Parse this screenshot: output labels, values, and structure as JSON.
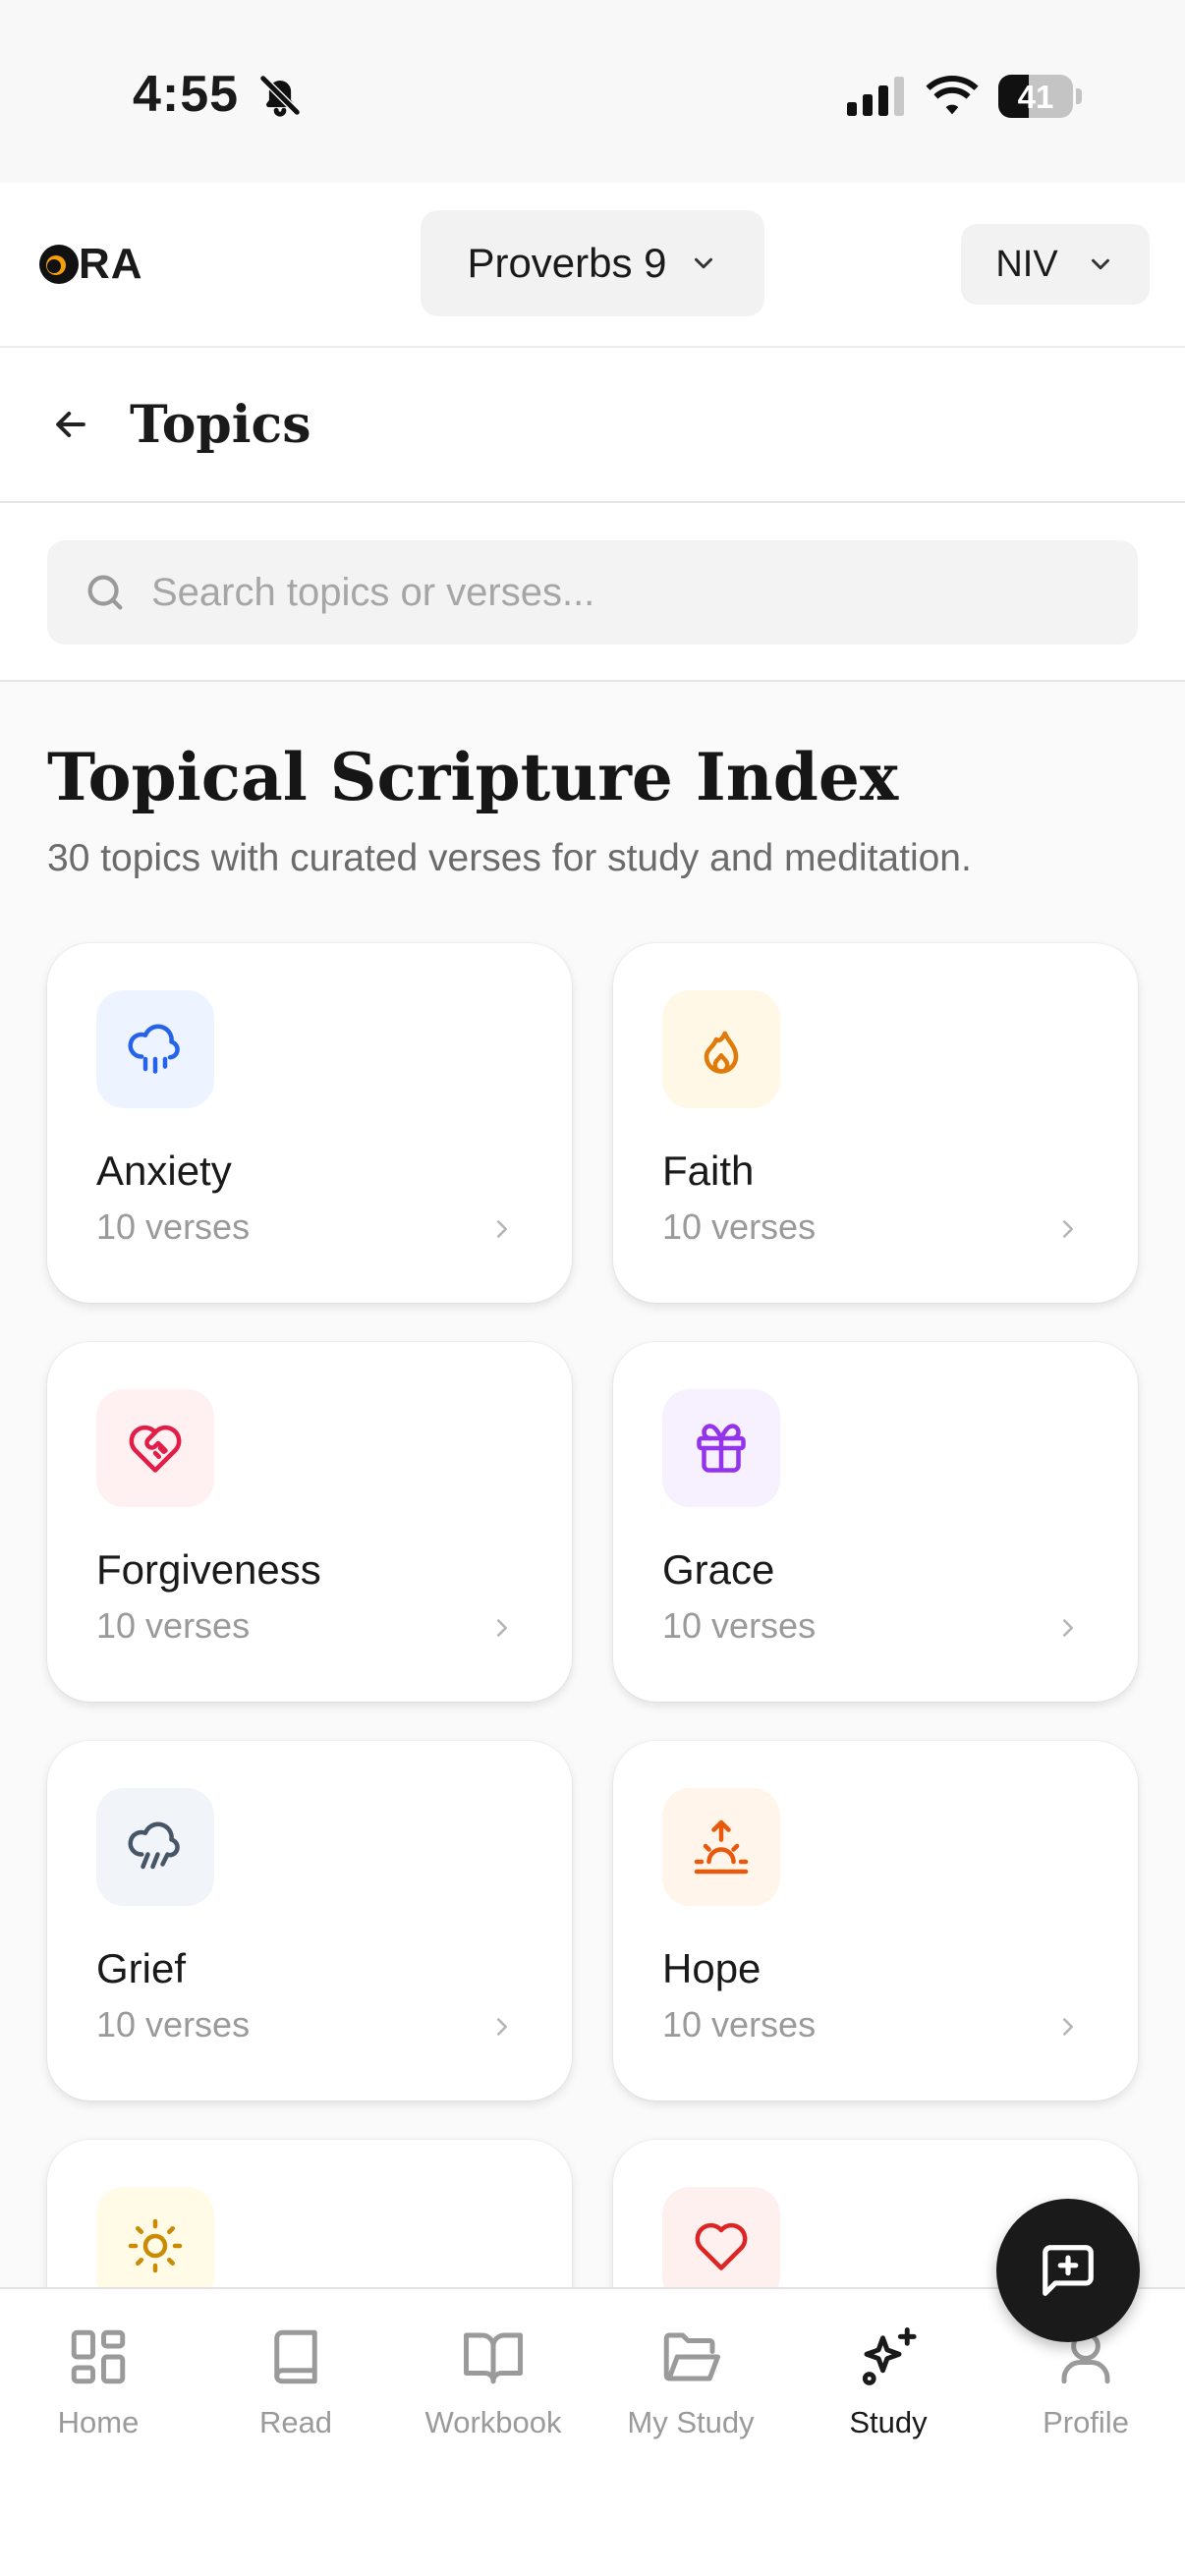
{
  "status_bar": {
    "time": "4:55",
    "battery_level": "41",
    "battery_fraction": 0.41
  },
  "header": {
    "logo_text": "RA",
    "chapter": "Proverbs 9",
    "version": "NIV"
  },
  "topics_bar": {
    "title": "Topics"
  },
  "search": {
    "placeholder": "Search topics or verses...",
    "value": ""
  },
  "main": {
    "title": "Topical Scripture Index",
    "subtitle": "30 topics with curated verses for study and meditation.",
    "topics": [
      {
        "name": "Anxiety",
        "count": "10 verses",
        "icon": "cloud-rain-icon",
        "color": "#2563eb",
        "bg": "#eef4ff"
      },
      {
        "name": "Faith",
        "count": "10 verses",
        "icon": "flame-icon",
        "color": "#e07b0b",
        "bg": "#fff8e6"
      },
      {
        "name": "Forgiveness",
        "count": "10 verses",
        "icon": "heart-handshake-icon",
        "color": "#e11d48",
        "bg": "#fff0f1"
      },
      {
        "name": "Grace",
        "count": "10 verses",
        "icon": "gift-icon",
        "color": "#9333ea",
        "bg": "#f7f0ff"
      },
      {
        "name": "Grief",
        "count": "10 verses",
        "icon": "cloud-drizzle-icon",
        "color": "#475569",
        "bg": "#f1f5f9"
      },
      {
        "name": "Hope",
        "count": "10 verses",
        "icon": "sunrise-icon",
        "color": "#ea580c",
        "bg": "#fff5ea"
      },
      {
        "name": "",
        "count": "",
        "icon": "sun-icon",
        "color": "#ca8a04",
        "bg": "#fffbe6"
      },
      {
        "name": "",
        "count": "",
        "icon": "heart-icon",
        "color": "#dc2626",
        "bg": "#fff0f0"
      }
    ]
  },
  "nav": {
    "items": [
      {
        "label": "Home",
        "icon": "grid-icon"
      },
      {
        "label": "Read",
        "icon": "book-icon"
      },
      {
        "label": "Workbook",
        "icon": "book-open-icon"
      },
      {
        "label": "My Study",
        "icon": "folder-open-icon"
      },
      {
        "label": "Study",
        "icon": "sparkles-icon",
        "active": true
      },
      {
        "label": "Profile",
        "icon": "user-icon"
      }
    ]
  },
  "colors": {
    "accent": "#1a1a1a",
    "inactive": "#9a9a9a"
  }
}
